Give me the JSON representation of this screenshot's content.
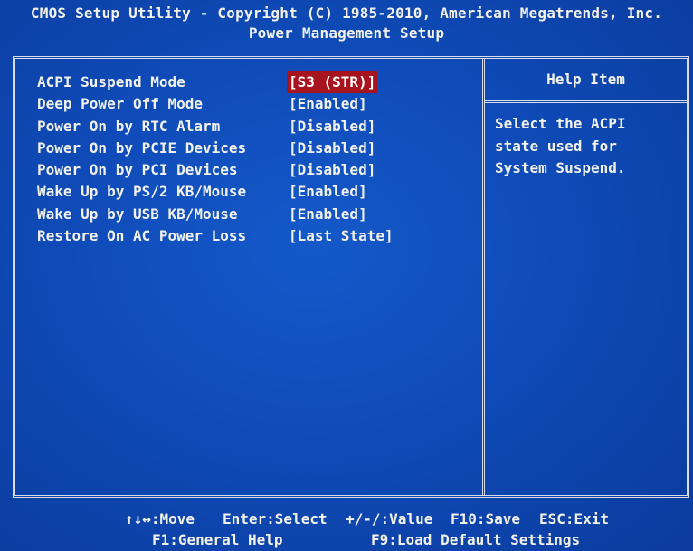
{
  "header": {
    "title": "CMOS Setup Utility - Copyright (C) 1985-2010, American Megatrends, Inc.",
    "subtitle": "Power Management Setup"
  },
  "settings": [
    {
      "label": "ACPI Suspend Mode",
      "value": "[S3 (STR)]",
      "selected": true
    },
    {
      "label": "Deep Power Off Mode",
      "value": "[Enabled]"
    },
    {
      "label": "Power On by RTC Alarm",
      "value": "[Disabled]"
    },
    {
      "label": "Power On by PCIE Devices",
      "value": "[Disabled]"
    },
    {
      "label": "Power On by PCI Devices",
      "value": "[Disabled]"
    },
    {
      "label": "Wake Up by PS/2 KB/Mouse",
      "value": "[Enabled]"
    },
    {
      "label": "Wake Up by USB KB/Mouse",
      "value": "[Enabled]"
    },
    {
      "label": "Restore On AC Power Loss",
      "value": "[Last State]"
    }
  ],
  "help": {
    "title": "Help Item",
    "lines": [
      "Select the ACPI",
      "state used for",
      "System Suspend."
    ]
  },
  "footer": {
    "move": "↑↓↔:Move",
    "enter": "Enter:Select",
    "value": "+/-/:Value",
    "save": "F10:Save",
    "exit": "ESC:Exit",
    "help": "F1:General Help",
    "defaults": "F9:Load Default Settings"
  },
  "colors": {
    "background": "#0f4bb8",
    "text": "#f2f2ea",
    "highlight": "#a8141e"
  }
}
